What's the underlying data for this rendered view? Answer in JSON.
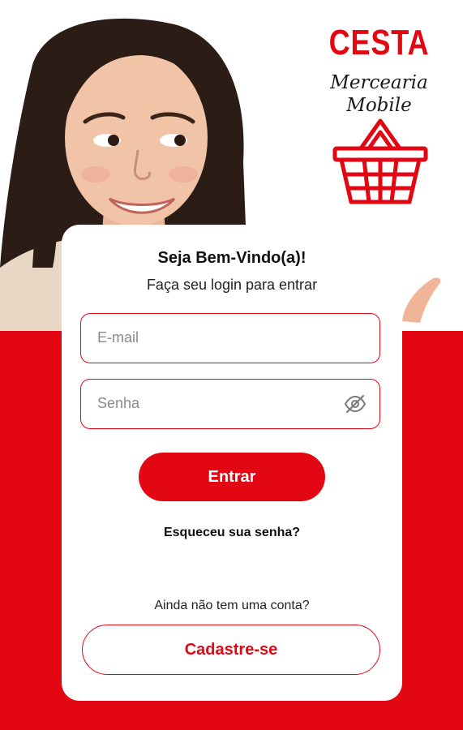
{
  "brand": {
    "name": "CESTA",
    "tagline": "Mercearia Mobile"
  },
  "login": {
    "title": "Seja Bem-Vindo(a)!",
    "subtitle": "Faça seu login para entrar",
    "email_placeholder": "E-mail",
    "password_placeholder": "Senha",
    "submit_label": "Entrar",
    "forgot_label": "Esqueceu sua senha?"
  },
  "signup": {
    "prompt": "Ainda não tem uma conta?",
    "button_label": "Cadastre-se"
  },
  "icons": {
    "basket": "basket-icon",
    "password_toggle": "eye-off-icon"
  },
  "colors": {
    "brand_red": "#e30613",
    "background": "#ffffff",
    "text_dark": "#111111"
  }
}
